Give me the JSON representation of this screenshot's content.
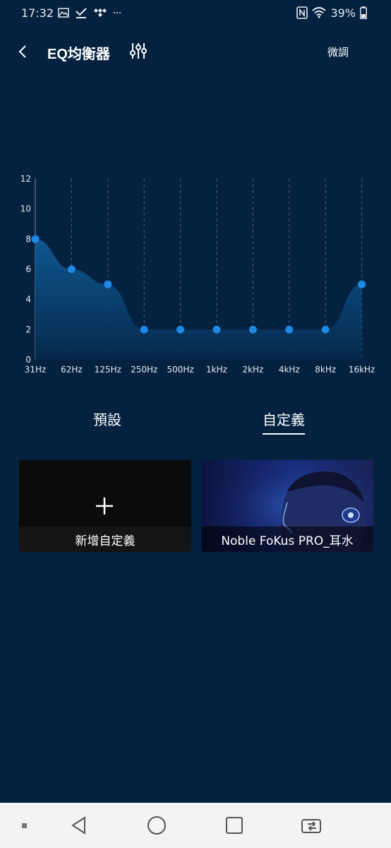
{
  "status_bar": {
    "time": "17:32",
    "battery": "39%",
    "icons_left": [
      "image-icon",
      "check-download-icon",
      "tidal-icon",
      "more-dots-icon"
    ],
    "icons_right": [
      "nfc-icon",
      "wifi-icon",
      "battery-icon"
    ]
  },
  "header": {
    "title": "EQ均衡器",
    "fine_tune_label": "微調"
  },
  "chart_data": {
    "type": "area",
    "categories": [
      "31Hz",
      "62Hz",
      "125Hz",
      "250Hz",
      "500Hz",
      "1kHz",
      "2kHz",
      "4kHz",
      "8kHz",
      "16kHz"
    ],
    "values": [
      8,
      6,
      5,
      2,
      2,
      2,
      2,
      2,
      2,
      5
    ],
    "ylim": [
      0,
      12
    ],
    "yticks": [
      0,
      2,
      4,
      6,
      8,
      10,
      12
    ],
    "title": "",
    "xlabel": "",
    "ylabel": "",
    "grid": "vertical dashed",
    "colors": {
      "point": "#1e88e5",
      "fill_top": "#0f5a96",
      "fill_bottom": "#062a4e",
      "grid": "#7b8fa6"
    }
  },
  "tabs": [
    {
      "label": "預設",
      "active": false
    },
    {
      "label": "自定義",
      "active": true
    }
  ],
  "cards": {
    "add": {
      "label": "新增自定義"
    },
    "preset": {
      "label": "Noble FoKus PRO_耳水"
    }
  },
  "colors": {
    "background": "#04213f",
    "accent": "#1e88e5",
    "nav_bar": "#f3f3f3"
  }
}
